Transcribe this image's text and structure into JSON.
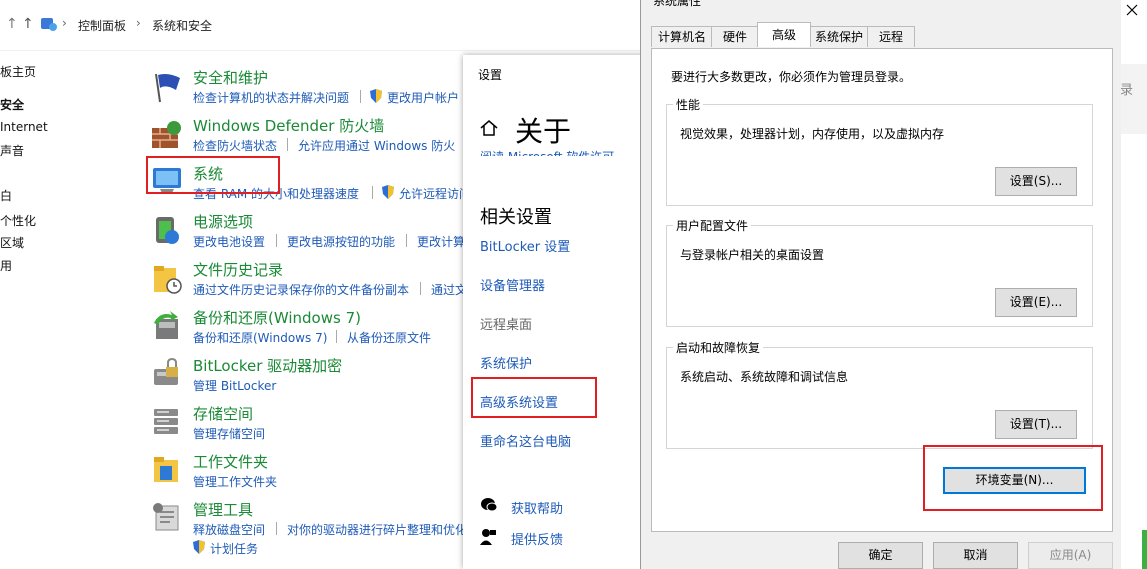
{
  "breadcrumb": {
    "item1": "控制面板",
    "item2": "系统和安全"
  },
  "left_nav": [
    "板主页",
    "安全",
    "Internet",
    "声音",
    "白",
    "个性化",
    "区域",
    "用"
  ],
  "categories": [
    {
      "title": "安全和维护",
      "links": [
        "检查计算机的状态并解决问题",
        "更改用户帐户"
      ]
    },
    {
      "title": "Windows Defender 防火墙",
      "links": [
        "检查防火墙状态",
        "允许应用通过 Windows 防火"
      ]
    },
    {
      "title": "系统",
      "links": [
        "查看 RAM 的大小和处理器速度",
        "允许远程访问"
      ]
    },
    {
      "title": "电源选项",
      "links": [
        "更改电池设置",
        "更改电源按钮的功能",
        "更改计算"
      ]
    },
    {
      "title": "文件历史记录",
      "links": [
        "通过文件历史记录保存你的文件备份副本",
        "通过文"
      ]
    },
    {
      "title": "备份和还原(Windows 7)",
      "links": [
        "备份和还原(Windows 7)",
        "从备份还原文件"
      ]
    },
    {
      "title": "BitLocker 驱动器加密",
      "links": [
        "管理 BitLocker"
      ]
    },
    {
      "title": "存储空间",
      "links": [
        "管理存储空间"
      ]
    },
    {
      "title": "工作文件夹",
      "links": [
        "管理工作文件夹"
      ]
    },
    {
      "title": "管理工具",
      "links": [
        "释放磁盘空间",
        "对你的驱动器进行碎片整理和优化",
        "计划任务"
      ]
    }
  ],
  "settings": {
    "header": "设置",
    "title": "关于",
    "partial_text": "阅读 Microsoft 软件许可",
    "related_title": "相关设置",
    "links": [
      "BitLocker 设置",
      "设备管理器",
      "远程桌面",
      "系统保护",
      "高级系统设置",
      "重命名这台电脑"
    ],
    "help": "获取帮助",
    "feedback": "提供反馈"
  },
  "dialog": {
    "title": "系统属性",
    "tabs": [
      "计算机名",
      "硬件",
      "高级",
      "系统保护",
      "远程"
    ],
    "admin_note": "要进行大多数更改，你必须作为管理员登录。",
    "groups": [
      {
        "label": "性能",
        "desc": "视觉效果，处理器计划，内存使用，以及虚拟内存",
        "button": "设置(S)..."
      },
      {
        "label": "用户配置文件",
        "desc": "与登录帐户相关的桌面设置",
        "button": "设置(E)..."
      },
      {
        "label": "启动和故障恢复",
        "desc": "系统启动、系统故障和调试信息",
        "button": "设置(T)..."
      }
    ],
    "env_button": "环境变量(N)...",
    "ok": "确定",
    "cancel": "取消",
    "apply": "应用(A)"
  },
  "right_edge": {
    "text": "录"
  },
  "colors": {
    "link": "#1e5bb8",
    "title_green": "#1a8a36",
    "highlight": "#e02020"
  }
}
